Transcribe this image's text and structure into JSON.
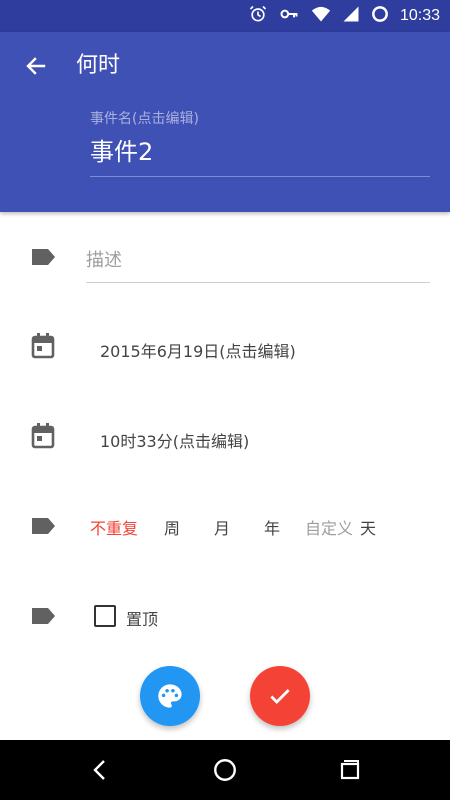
{
  "status_bar": {
    "time": "10:33",
    "icons": [
      "alarm-icon",
      "key-icon",
      "wifi-icon",
      "signal-icon",
      "battery-icon"
    ]
  },
  "app_bar": {
    "title": "何时",
    "event_label": "事件名(点击编辑)",
    "event_name": "事件2"
  },
  "form": {
    "description_placeholder": "描述",
    "description_value": "",
    "date": "2015年6月19日(点击编辑)",
    "time": "10时33分(点击编辑)",
    "repeat_options": [
      "不重复",
      "周",
      "月",
      "年",
      "自定义",
      "天"
    ],
    "repeat_selected": "不重复",
    "pin_label": "置顶",
    "pin_checked": false
  },
  "actions": {
    "palette": "palette-icon",
    "confirm": "check-icon"
  },
  "colors": {
    "primary": "#3f51b5",
    "status_bar": "#2e3d9e",
    "accent_red": "#f44336",
    "fab_blue": "#2196f3"
  }
}
